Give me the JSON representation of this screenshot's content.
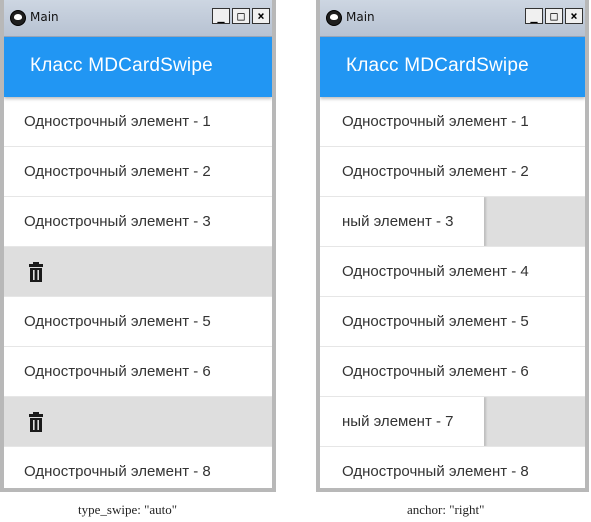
{
  "windows": [
    {
      "title": "Main",
      "toolbar_title": "Класс MDCardSwipe",
      "rows": [
        {
          "label": "Однострочный элемент -  1"
        },
        {
          "label": "Однострочный элемент -  2"
        },
        {
          "label": "Однострочный элемент -  3"
        },
        {
          "label": ""
        },
        {
          "label": "Однострочный элемент -  5"
        },
        {
          "label": "Однострочный элемент -  6"
        },
        {
          "label": ""
        },
        {
          "label": "Однострочный элемент -  8"
        }
      ]
    },
    {
      "title": "Main",
      "toolbar_title": "Класс MDCardSwipe",
      "rows": [
        {
          "label": "Однострочный элемент -  1"
        },
        {
          "label": "Однострочный элемент -  2"
        },
        {
          "label": "ный элемент -  3"
        },
        {
          "label": "Однострочный элемент -  4"
        },
        {
          "label": "Однострочный элемент -  5"
        },
        {
          "label": "Однострочный элемент -  6"
        },
        {
          "label": "ный элемент -  7"
        },
        {
          "label": "Однострочный элемент -  8"
        }
      ]
    }
  ],
  "window_controls": {
    "minimize": "_",
    "maximize": "□",
    "close": "×"
  },
  "icons": {
    "trash": "trash-icon",
    "app": "kivy-app-icon"
  },
  "colors": {
    "toolbar": "#2196f3",
    "swipe_background": "#dedede"
  },
  "captions": {
    "left": "type_swipe: \"auto\"",
    "right": "anchor: \"right\""
  }
}
